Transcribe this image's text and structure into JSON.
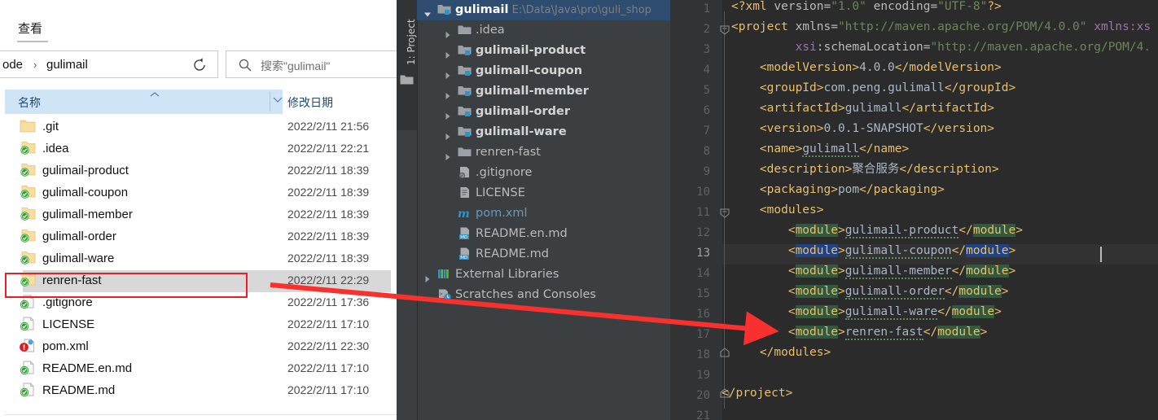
{
  "explorer": {
    "ribbon_tab": "查看",
    "breadcrumb": {
      "part1": "ode",
      "separator": "›",
      "part2": "gulimail"
    },
    "breadcrumb_dropdown_icon": "chevron-down-icon",
    "refresh_icon": "refresh-icon",
    "search": {
      "icon": "search-icon",
      "placeholder": "搜索\"gulimail\""
    },
    "columns": {
      "name": "名称",
      "date_modified": "修改日期",
      "sort_icon": "caret-up-icon",
      "chevron_icon": "chevron-down-icon"
    },
    "files": [
      {
        "name": ".git",
        "date": "2022/2/11 21:56",
        "icon": "folder-icon",
        "selected": false
      },
      {
        "name": ".idea",
        "date": "2022/2/11 22:21",
        "icon": "folder-synced-icon",
        "selected": false
      },
      {
        "name": "gulimail-product",
        "date": "2022/2/11 18:39",
        "icon": "folder-synced-icon",
        "selected": false
      },
      {
        "name": "gulimall-coupon",
        "date": "2022/2/11 18:39",
        "icon": "folder-synced-icon",
        "selected": false
      },
      {
        "name": "gulimall-member",
        "date": "2022/2/11 18:39",
        "icon": "folder-synced-icon",
        "selected": false
      },
      {
        "name": "gulimall-order",
        "date": "2022/2/11 18:39",
        "icon": "folder-synced-icon",
        "selected": false
      },
      {
        "name": "gulimall-ware",
        "date": "2022/2/11 18:39",
        "icon": "folder-synced-icon",
        "selected": false
      },
      {
        "name": "renren-fast",
        "date": "2022/2/11 22:29",
        "icon": "folder-synced-icon",
        "selected": true
      },
      {
        "name": ".gitignore",
        "date": "2022/2/11 17:36",
        "icon": "file-synced-icon",
        "selected": false
      },
      {
        "name": "LICENSE",
        "date": "2022/2/11 17:10",
        "icon": "file-synced-icon",
        "selected": false
      },
      {
        "name": "pom.xml",
        "date": "2022/2/11 22:30",
        "icon": "maven-file-icon",
        "selected": false
      },
      {
        "name": "README.en.md",
        "date": "2022/2/11 17:10",
        "icon": "file-synced-icon",
        "selected": false
      },
      {
        "name": "README.md",
        "date": "2022/2/11 17:10",
        "icon": "file-synced-icon",
        "selected": false
      }
    ]
  },
  "ide": {
    "tool_window_tab": "1: Project",
    "tree": [
      {
        "label": "gulimail",
        "path": "E:\\Data\\Java\\pro\\guli_shop",
        "indent": 0,
        "arrow": "down",
        "icon": "module-folder-icon",
        "selected": true
      },
      {
        "label": ".idea",
        "indent": 1,
        "arrow": "right",
        "icon": "folder-icon",
        "selected": false
      },
      {
        "label": "gulimail-product",
        "indent": 1,
        "arrow": "right",
        "icon": "module-folder-icon",
        "selected": false,
        "bold": true
      },
      {
        "label": "gulimall-coupon",
        "indent": 1,
        "arrow": "right",
        "icon": "module-folder-icon",
        "selected": false,
        "bold": true
      },
      {
        "label": "gulimall-member",
        "indent": 1,
        "arrow": "right",
        "icon": "module-folder-icon",
        "selected": false,
        "bold": true
      },
      {
        "label": "gulimall-order",
        "indent": 1,
        "arrow": "right",
        "icon": "module-folder-icon",
        "selected": false,
        "bold": true
      },
      {
        "label": "gulimall-ware",
        "indent": 1,
        "arrow": "right",
        "icon": "module-folder-icon",
        "selected": false,
        "bold": true
      },
      {
        "label": "renren-fast",
        "indent": 1,
        "arrow": "right",
        "icon": "folder-icon",
        "selected": false
      },
      {
        "label": ".gitignore",
        "indent": 1,
        "arrow": "none",
        "icon": "gitignore-file-icon",
        "selected": false
      },
      {
        "label": "LICENSE",
        "indent": 1,
        "arrow": "none",
        "icon": "text-file-icon",
        "selected": false
      },
      {
        "label": "pom.xml",
        "indent": 1,
        "arrow": "none",
        "icon": "maven-file-icon",
        "selected": false,
        "color": "#6897bb"
      },
      {
        "label": "README.en.md",
        "indent": 1,
        "arrow": "none",
        "icon": "markdown-file-icon",
        "selected": false
      },
      {
        "label": "README.md",
        "indent": 1,
        "arrow": "none",
        "icon": "markdown-file-icon",
        "selected": false
      },
      {
        "label": "External Libraries",
        "indent": 0,
        "arrow": "right",
        "icon": "libraries-icon",
        "selected": false
      },
      {
        "label": "Scratches and Consoles",
        "indent": 0,
        "arrow": "none",
        "icon": "scratches-icon",
        "selected": false
      }
    ],
    "editor": {
      "current_line": 13,
      "line_numbers": [
        1,
        2,
        3,
        4,
        5,
        6,
        7,
        8,
        9,
        10,
        11,
        12,
        13,
        14,
        15,
        16,
        17,
        18,
        19,
        20,
        21
      ],
      "code_lines": [
        "<?xml version=\"1.0\" encoding=\"UTF-8\"?>",
        "<project xmlns=\"http://maven.apache.org/POM/4.0.0\" xmlns:xs",
        "         xsi:schemaLocation=\"http://maven.apache.org/POM/4.",
        "    <modelVersion>4.0.0</modelVersion>",
        "    <groupId>com.peng.gulimall</groupId>",
        "    <artifactId>gulimall</artifactId>",
        "    <version>0.0.1-SNAPSHOT</version>",
        "    <name>gulimall</name>",
        "    <description>聚合服务</description>",
        "    <packaging>pom</packaging>",
        "    <modules>",
        "        <module>gulimail-product</module>",
        "        <module>gulimall-coupon</module>",
        "        <module>gulimall-member</module>",
        "        <module>gulimall-order</module>",
        "        <module>gulimall-ware</module>",
        "        <module>renren-fast</module>",
        "    </modules>",
        "",
        "</project>",
        ""
      ]
    }
  },
  "annotations": {
    "arrow_color": "#f8312f",
    "highlight_box_color": "#ee1c25",
    "explorer_highlight_target": "renren-fast",
    "editor_highlight_target": "<module>renren-fast</module>"
  }
}
